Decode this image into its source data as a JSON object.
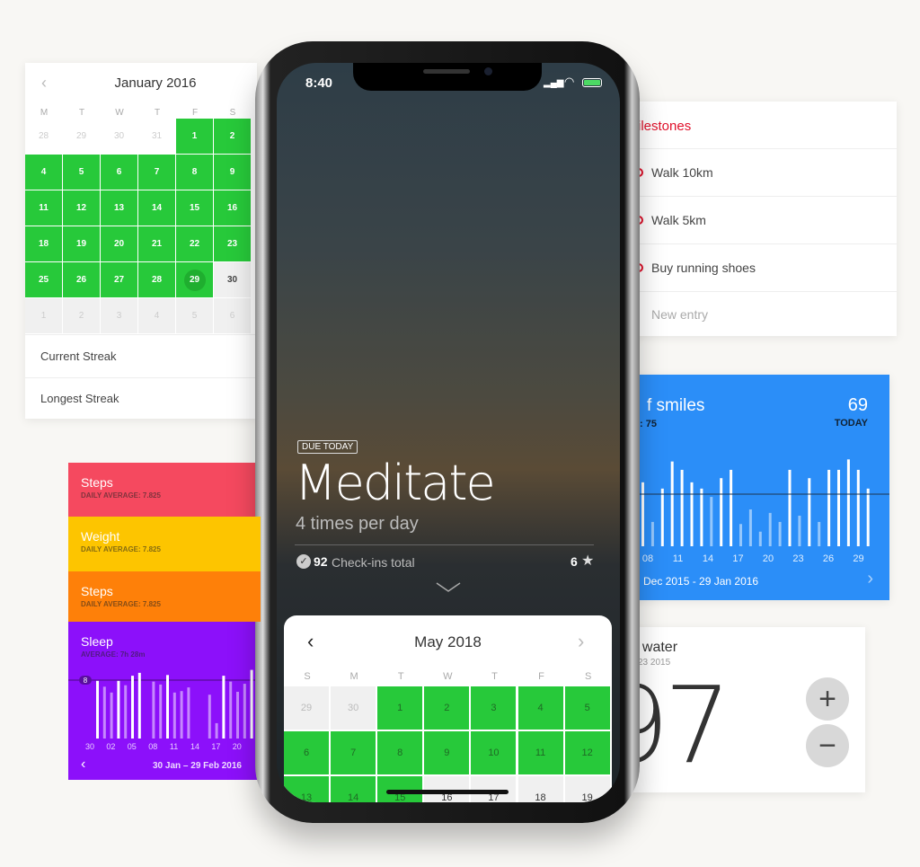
{
  "january_calendar": {
    "title": "January 2016",
    "weekdays": [
      "M",
      "T",
      "W",
      "T",
      "F",
      "S"
    ],
    "weeks": [
      [
        "28",
        "29",
        "30",
        "31",
        "1",
        "2"
      ],
      [
        "4",
        "5",
        "6",
        "7",
        "8",
        "9"
      ],
      [
        "11",
        "12",
        "13",
        "14",
        "15",
        "16"
      ],
      [
        "18",
        "19",
        "20",
        "21",
        "22",
        "23"
      ],
      [
        "25",
        "26",
        "27",
        "28",
        "29",
        "30"
      ],
      [
        "1",
        "2",
        "3",
        "4",
        "5",
        "6"
      ]
    ],
    "current_streak_label": "Current Streak",
    "longest_streak_label": "Longest Streak"
  },
  "stat_cards": [
    {
      "title": "Steps",
      "subtitle": "DAILY AVERAGE: 7.825",
      "color": "#f5495f"
    },
    {
      "title": "Weight",
      "subtitle": "DAILY AVERAGE: 7.825",
      "color": "#fdc500"
    },
    {
      "title": "Steps",
      "subtitle": "DAILY AVERAGE: 7.825",
      "color": "#fe8009"
    }
  ],
  "sleep": {
    "title": "Sleep",
    "subtitle": "AVERAGE: 7h 28m",
    "color": "#8c10fa",
    "avg_label": "8",
    "avg": 8,
    "date_range": "30 Jan – 29 Feb 2016",
    "x_labels": [
      "30",
      "02",
      "05",
      "08",
      "11",
      "14",
      "17",
      "20"
    ],
    "values": [
      7.9,
      7.1,
      6.3,
      7.9,
      7.3,
      8.6,
      9.0,
      null,
      7.8,
      7.4,
      8.7,
      6.3,
      6.5,
      7.0,
      null,
      null,
      6.0,
      2.1,
      8.6,
      7.8,
      6.4,
      7.5,
      9.4
    ]
  },
  "milestones": {
    "title": "ilestones",
    "accent": "#e0102a",
    "items": [
      "Walk 10km",
      "Walk 5km",
      "Buy running shoes"
    ],
    "new_entry_placeholder": "New entry"
  },
  "smiles": {
    "title": "f smiles",
    "subtitle": ": 75",
    "today_value": "69",
    "today_label": "TODAY",
    "avg": 75,
    "color": "#2b8ef8",
    "date_range": "Dec 2015 - 29 Jan 2016",
    "x_labels": [
      "08",
      "11",
      "14",
      "17",
      "20",
      "23",
      "26",
      "29"
    ],
    "values": [
      92,
      35,
      83,
      122,
      110,
      92,
      83,
      71,
      98,
      110,
      32,
      53,
      21,
      48,
      35,
      110,
      44,
      98,
      35,
      110,
      110,
      125,
      110,
      83
    ]
  },
  "water": {
    "title": "f water",
    "subtitle": "23 2015",
    "value": "97",
    "plus": "+",
    "minus": "−"
  },
  "phone": {
    "time": "8:40",
    "badge": "DUE TODAY",
    "habit": "Meditate",
    "frequency": "4 times per day",
    "checkins_count": "92",
    "checkins_label": "Check-ins total",
    "stars": "6",
    "calendar": {
      "title": "May 2018",
      "weekdays": [
        "S",
        "M",
        "T",
        "W",
        "T",
        "F",
        "S"
      ],
      "weeks": [
        [
          "29",
          "30",
          "1",
          "2",
          "3",
          "4",
          "5"
        ],
        [
          "6",
          "7",
          "8",
          "9",
          "10",
          "11",
          "12"
        ],
        [
          "13",
          "14",
          "15",
          "16",
          "17",
          "18",
          "19"
        ]
      ]
    }
  }
}
